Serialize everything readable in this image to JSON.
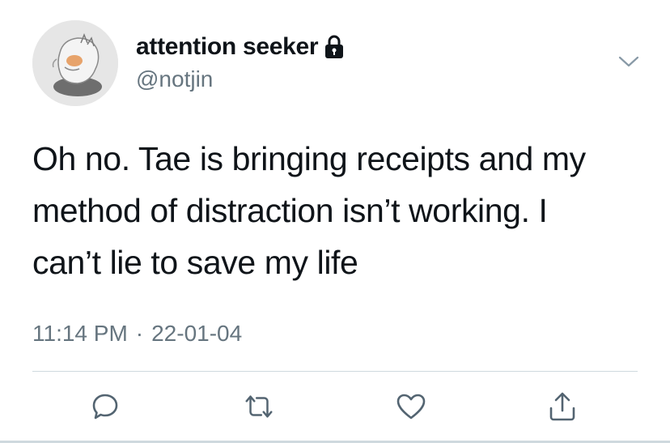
{
  "profile": {
    "display_name": "attention seeker",
    "handle": "@notjin",
    "avatar_icon": "avatar-image",
    "protected_icon": "lock-icon"
  },
  "tweet": {
    "text": "Oh no. Tae is bringing receipts and my\nmethod of distraction isn’t working. I\ncan’t lie to save my life",
    "time": "11:14 PM",
    "separator": "·",
    "date": "22-01-04"
  },
  "actions": [
    {
      "icon": "reply-icon"
    },
    {
      "icon": "retweet-icon"
    },
    {
      "icon": "like-icon"
    },
    {
      "icon": "share-icon"
    }
  ],
  "colors": {
    "text": "#0f1419",
    "secondary": "#66757f",
    "divider": "#cfd9de"
  }
}
